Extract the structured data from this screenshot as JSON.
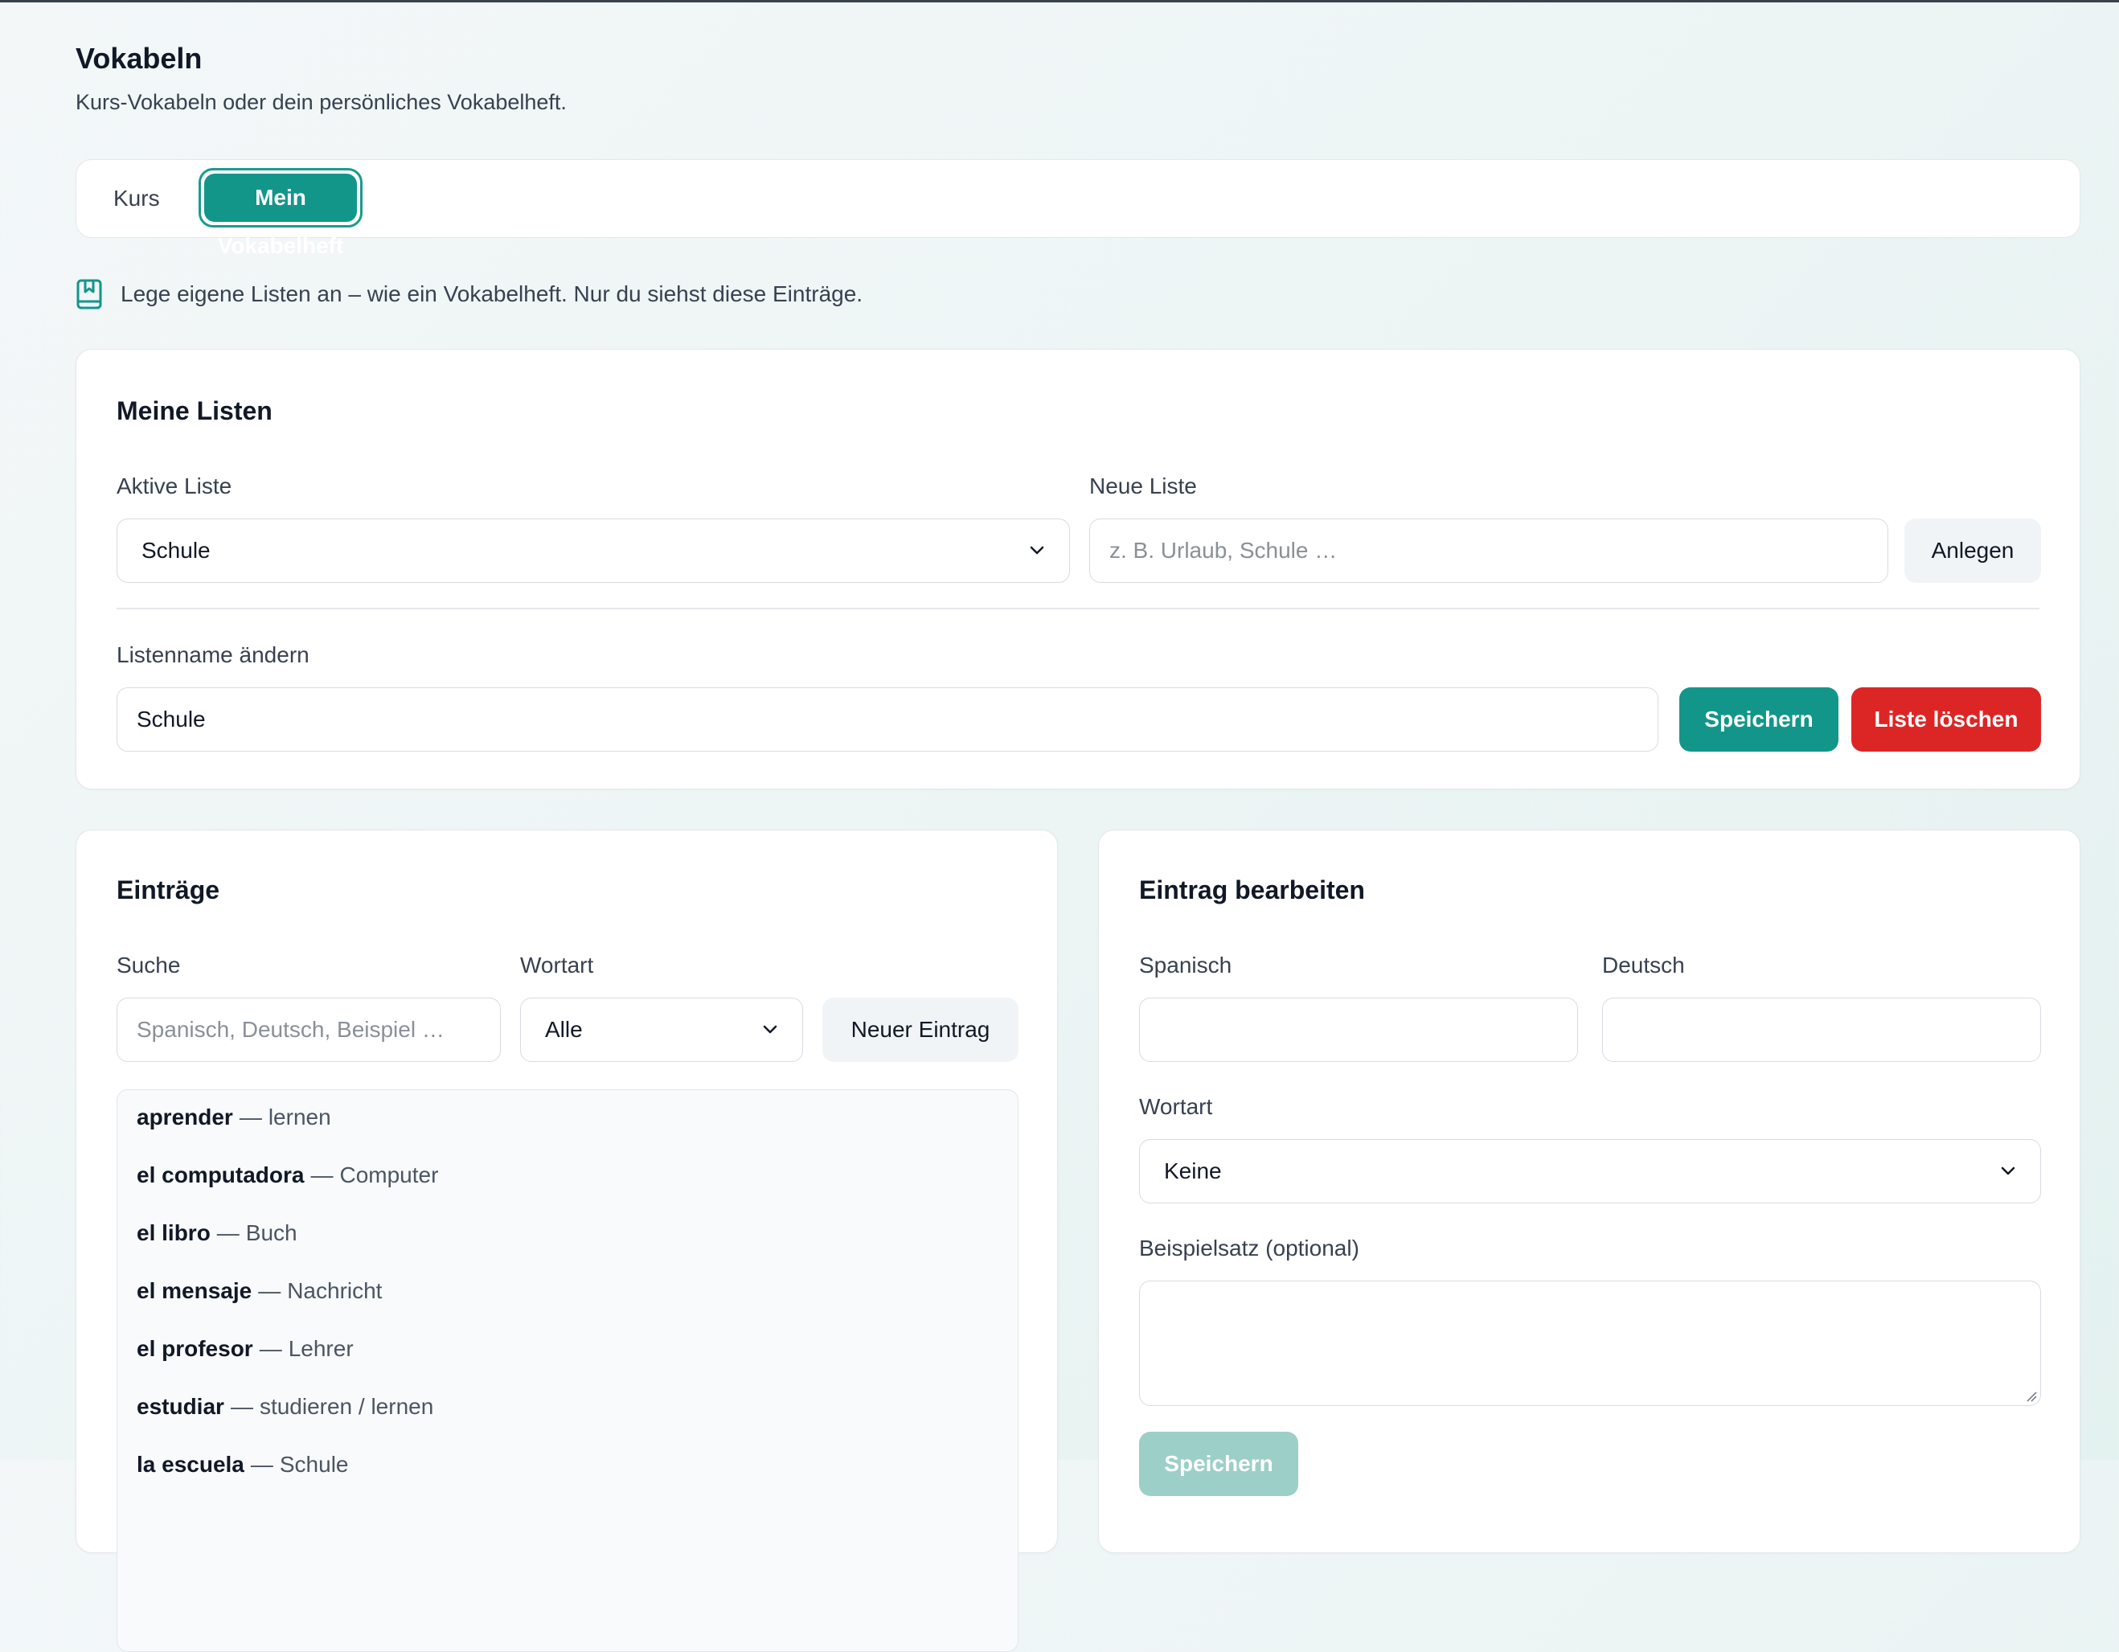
{
  "page": {
    "title": "Vokabeln",
    "subtitle": "Kurs-Vokabeln oder dein persönliches Vokabelheft."
  },
  "tabs": [
    {
      "label": "Kurs",
      "active": false
    },
    {
      "label": "Mein Vokabelheft",
      "active": true
    }
  ],
  "info": {
    "icon": "notebook-bookmark-icon",
    "text": "Lege eigene Listen an – wie ein Vokabelheft. Nur du siehst diese Einträge."
  },
  "lists": {
    "title": "Meine Listen",
    "active_label": "Aktive Liste",
    "active_value": "Schule",
    "new_label": "Neue Liste",
    "new_placeholder": "z. B. Urlaub, Schule …",
    "create_button": "Anlegen",
    "rename_label": "Listenname ändern",
    "rename_value": "Schule",
    "save_button": "Speichern",
    "delete_button": "Liste löschen"
  },
  "entries": {
    "title": "Einträge",
    "search_label": "Suche",
    "search_placeholder": "Spanisch, Deutsch, Beispiel …",
    "type_label": "Wortart",
    "type_value": "Alle",
    "new_button": "Neuer Eintrag",
    "separator": "—",
    "items": [
      {
        "es": "aprender",
        "de": "lernen"
      },
      {
        "es": "el computadora",
        "de": "Computer"
      },
      {
        "es": "el libro",
        "de": "Buch"
      },
      {
        "es": "el mensaje",
        "de": "Nachricht"
      },
      {
        "es": "el profesor",
        "de": "Lehrer"
      },
      {
        "es": "estudiar",
        "de": "studieren / lernen"
      },
      {
        "es": "la escuela",
        "de": "Schule"
      }
    ]
  },
  "edit": {
    "title": "Eintrag bearbeiten",
    "spanish_label": "Spanisch",
    "spanish_value": "",
    "german_label": "Deutsch",
    "german_value": "",
    "type_label": "Wortart",
    "type_value": "Keine",
    "example_label": "Beispielsatz (optional)",
    "example_value": "",
    "save_button": "Speichern"
  },
  "colors": {
    "accent": "#13968a",
    "danger": "#dc2626",
    "disabled": "#9ccfc8"
  }
}
